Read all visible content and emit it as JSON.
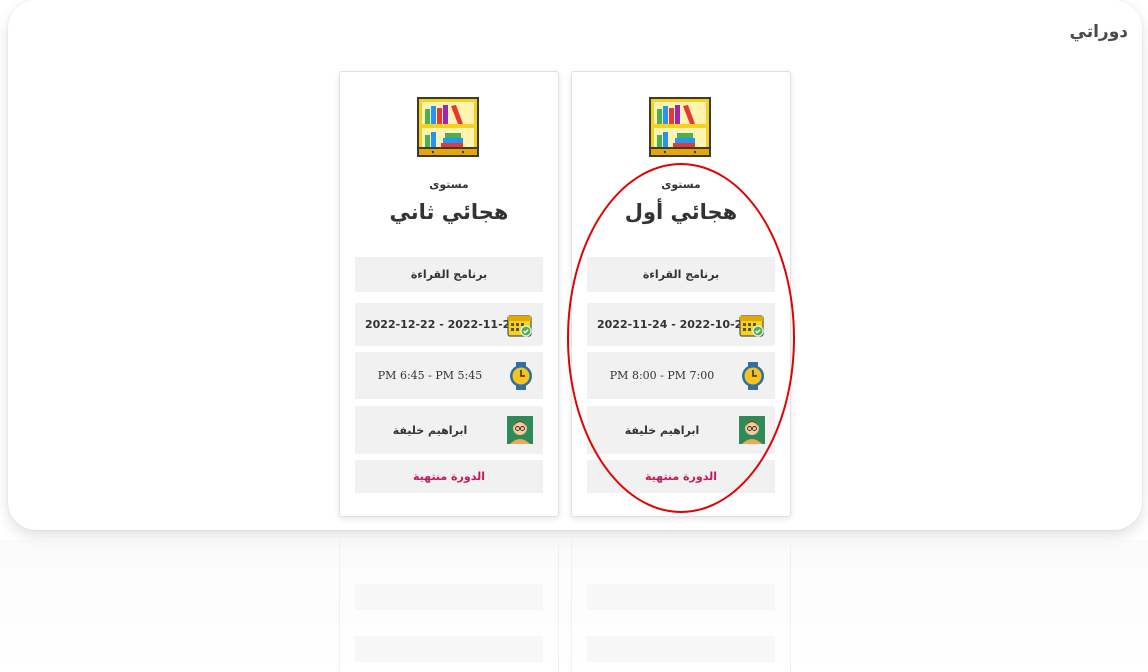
{
  "page": {
    "title": "دوراتي"
  },
  "courses": [
    {
      "level_label": "مستوى",
      "name": "هجائي أول",
      "program": "برنامج القراءة",
      "dates": "2022-11-24  -  2022-10-29",
      "time": "PM 8:00   -   PM 7:00",
      "teacher": "ابراهيم خليفة",
      "status": "الدورة منتهية"
    },
    {
      "level_label": "مستوى",
      "name": "هجائي ثاني",
      "program": "برنامج القراءة",
      "dates": "2022-12-22  -  2022-11-26",
      "time": "PM 6:45   -   PM 5:45",
      "teacher": "ابراهيم خليفة",
      "status": "الدورة منتهية"
    }
  ],
  "icons": {
    "course": "bookshelf-icon",
    "dates": "calendar-icon",
    "time": "clock-icon",
    "teacher": "teacher-avatar-icon"
  },
  "colors": {
    "status": "#c2185b",
    "highlight_ring": "#e30000",
    "row_bg": "#f1f1f1"
  }
}
